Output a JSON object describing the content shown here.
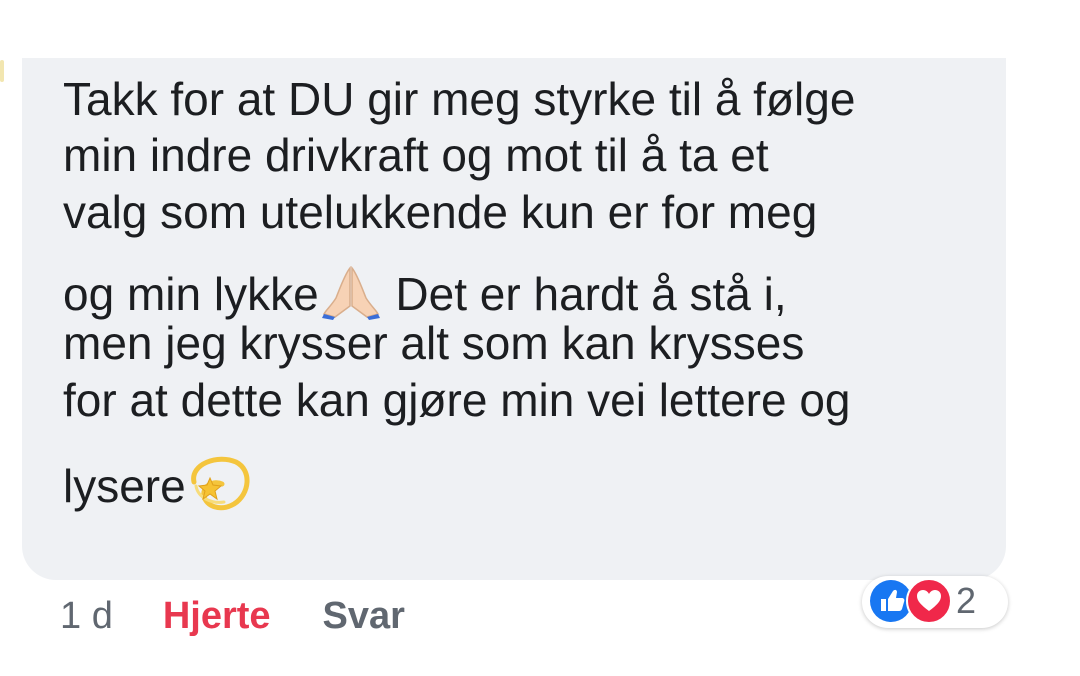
{
  "comment": {
    "lines": [
      "Takk for at DU gir meg styrke til å følge",
      "min indre drivkraft og mot til å ta et",
      "valg som utelukkende kun er for meg",
      "og min lykke",
      " Det er hardt å stå i,",
      "men jeg krysser alt som kan krysses",
      "for at dette kan gjøre min vei lettere og",
      "lysere"
    ],
    "emojis": [
      "folded-hands-emoji",
      "dizzy-star-emoji"
    ]
  },
  "meta": {
    "time": "1 d",
    "love_label": "Hjerte",
    "reply_label": "Svar"
  },
  "reactions": {
    "icons": [
      "like-icon",
      "heart-icon"
    ],
    "count": "2"
  },
  "colors": {
    "bubble": "#eff1f4",
    "text": "#1c1e21",
    "meta_text": "#606770",
    "love_label": "#e8384f",
    "like_blue": "#1877f2",
    "heart_red": "#f0284a"
  }
}
